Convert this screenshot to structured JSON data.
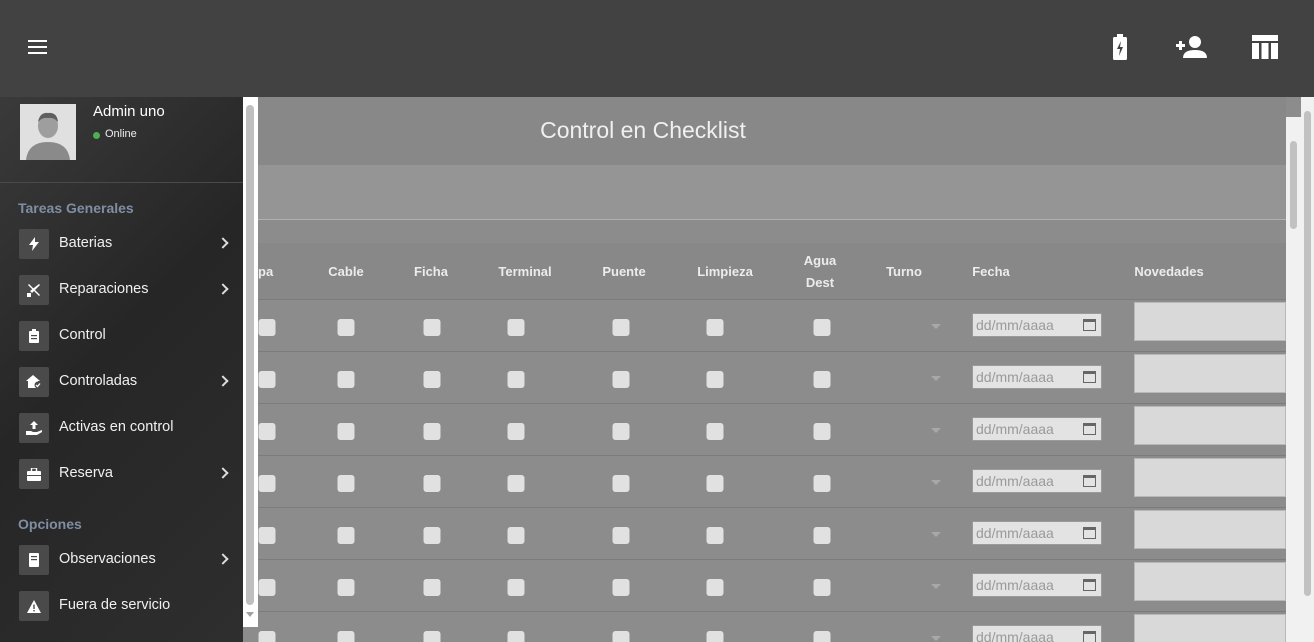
{
  "topbar": {
    "menu_icon": "hamburger-icon",
    "actions": [
      {
        "name": "battery-charging-icon"
      },
      {
        "name": "person-add-icon"
      },
      {
        "name": "table-layout-icon"
      }
    ]
  },
  "user": {
    "name": "Admin uno",
    "status": "Online"
  },
  "sidebar": {
    "sections": [
      {
        "title": "Tareas Generales",
        "items": [
          {
            "label": "Baterias",
            "icon": "bolt-icon",
            "chevron": true
          },
          {
            "label": "Reparaciones",
            "icon": "tools-icon",
            "chevron": true
          },
          {
            "label": "Control",
            "icon": "clipboard-icon",
            "chevron": false
          },
          {
            "label": "Controladas",
            "icon": "home-check-icon",
            "chevron": true
          },
          {
            "label": "Activas en control",
            "icon": "hand-upload-icon",
            "chevron": false
          },
          {
            "label": "Reserva",
            "icon": "briefcase-icon",
            "chevron": true
          }
        ]
      },
      {
        "title": "Opciones",
        "items": [
          {
            "label": "Observaciones",
            "icon": "book-icon",
            "chevron": true
          },
          {
            "label": "Fuera de servicio",
            "icon": "warning-icon",
            "chevron": false
          }
        ]
      }
    ]
  },
  "main": {
    "title": "Control en Checklist",
    "columns": [
      "apa",
      "Cable",
      "Ficha",
      "Terminal",
      "Puente",
      "Limpieza",
      "Agua\nDest",
      "Turno",
      "Fecha",
      "Novedades"
    ],
    "date_placeholder": "dd/mm/aaaa",
    "rows": 7
  },
  "colors": {
    "topbar": "#424242",
    "sidebar": "#2b2b2b",
    "online": "#4caf50",
    "section": "#7f8ea3"
  }
}
